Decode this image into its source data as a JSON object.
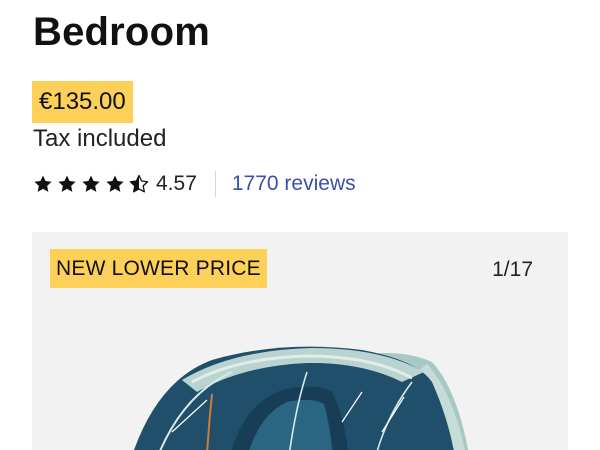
{
  "product": {
    "title_line": "Bedroom",
    "price": "€135.00",
    "tax_note": "Tax included",
    "rating_value": "4.57",
    "reviews_link": "1770 reviews",
    "rating": 4.57,
    "rating_max": 5
  },
  "gallery": {
    "badge": "NEW LOWER PRICE",
    "counter": "1/17",
    "image": "tent-product-photo"
  },
  "colors": {
    "highlight": "#fdd05a",
    "link": "#3a4fb0",
    "gallery_bg": "#f2f2f2"
  },
  "icons": [
    "star-icon",
    "half-star-icon"
  ]
}
